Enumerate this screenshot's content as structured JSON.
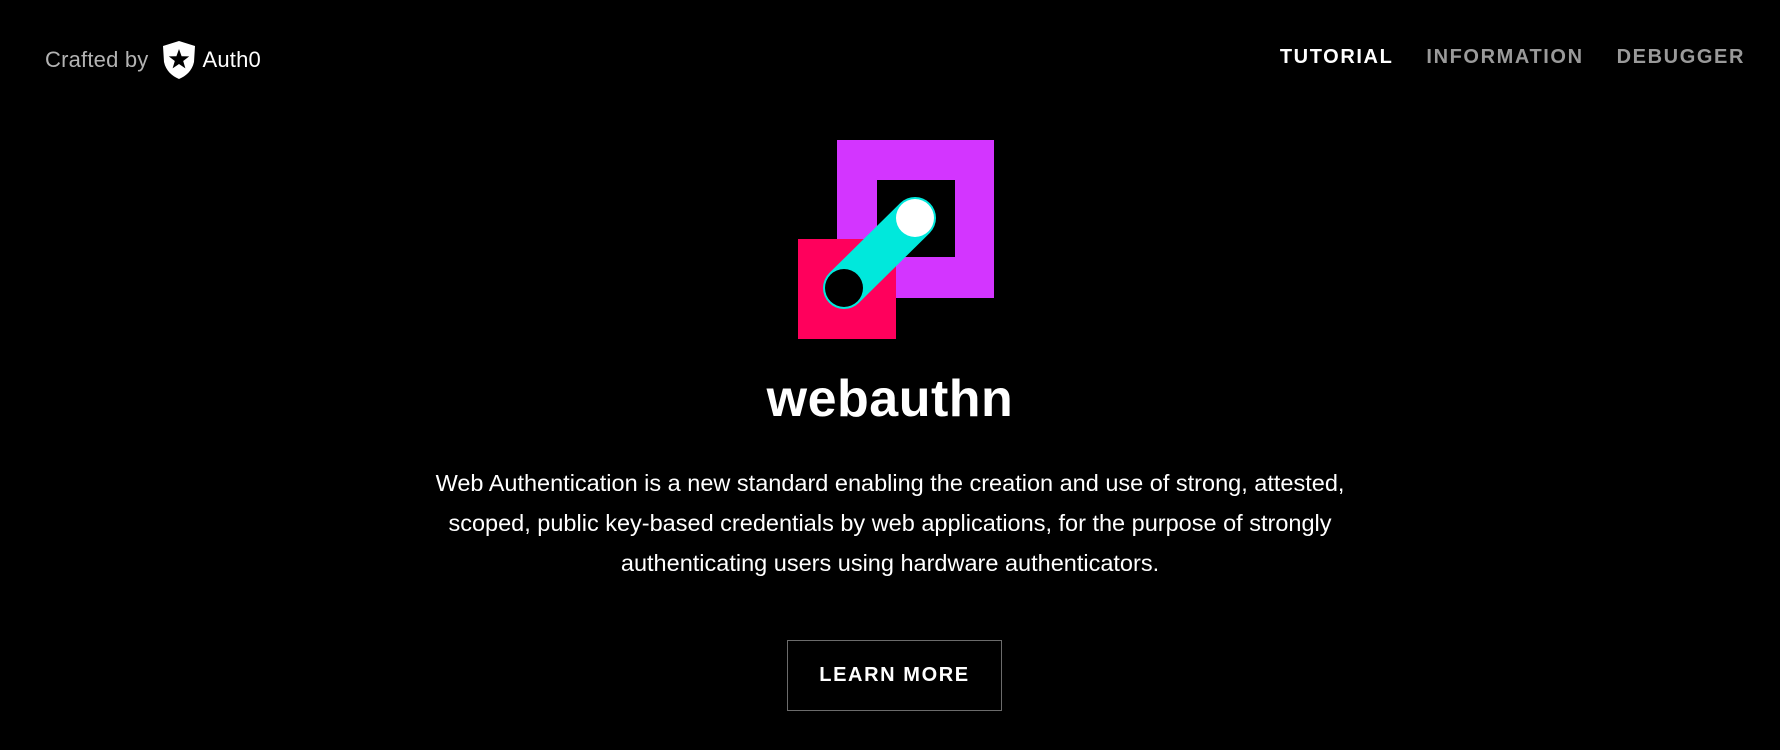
{
  "header": {
    "crafted_by_label": "Crafted by",
    "brand_name": "Auth0",
    "brand_icon": "auth0-star-shield-icon"
  },
  "nav": {
    "items": [
      {
        "label": "TUTORIAL",
        "active": true
      },
      {
        "label": "INFORMATION",
        "active": false
      },
      {
        "label": "DEBUGGER",
        "active": false
      }
    ]
  },
  "hero": {
    "logo_icon": "webauthn-logo-icon",
    "title": "webauthn",
    "description_lines": [
      "Web Authentication is a new standard enabling the creation and use of strong, attested,",
      "scoped, public key-based credentials by web applications, for the purpose of strongly",
      "authenticating users using hardware authenticators."
    ],
    "cta_label": "LEARN MORE"
  },
  "colors": {
    "background": "#000000",
    "logo_purple": "#d335ff",
    "logo_pink": "#ff005c",
    "logo_cyan": "#00e8dc",
    "nav_inactive": "#9a9a9a",
    "text": "#ffffff"
  }
}
